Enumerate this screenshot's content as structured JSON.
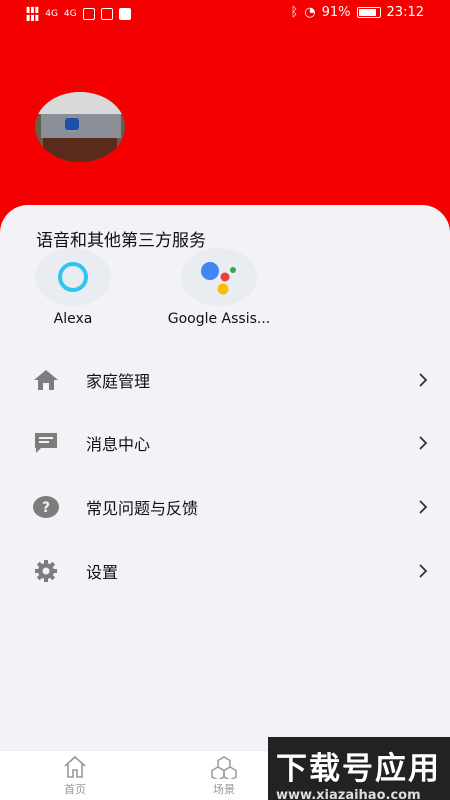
{
  "status_bar": {
    "battery": "91%",
    "time": "23:12",
    "signal_1": "4G",
    "signal_2": "4G"
  },
  "profile": {
    "avatar": "avatar-photo"
  },
  "third_party": {
    "title": "语音和其他第三方服务",
    "services": [
      {
        "label": "Alexa",
        "icon": "alexa-icon"
      },
      {
        "label": "Google Assis...",
        "icon": "google-assistant-icon"
      }
    ]
  },
  "menu": [
    {
      "label": "家庭管理",
      "icon": "home-icon"
    },
    {
      "label": "消息中心",
      "icon": "message-icon"
    },
    {
      "label": "常见问题与反馈",
      "icon": "help-icon"
    },
    {
      "label": "设置",
      "icon": "settings-icon"
    }
  ],
  "tabs": [
    {
      "label": "首页",
      "icon": "home-outline-icon"
    },
    {
      "label": "场景",
      "icon": "scene-icon"
    }
  ],
  "watermark": {
    "title": "下载号应用",
    "url": "www.xiazaihao.com"
  },
  "colors": {
    "header": "#f40000",
    "card": "#f3f3f7",
    "icon_gray": "#7d7d7d",
    "alexa": "#2ec5ef"
  }
}
